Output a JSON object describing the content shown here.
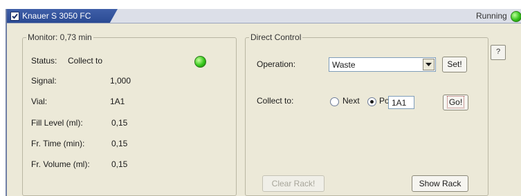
{
  "window": {
    "tab_title": "Knauer S 3050 FC",
    "enabled_checkbox": true,
    "status_text": "Running",
    "status_color": "#35c21b"
  },
  "monitor": {
    "legend": "Monitor: 0,73 min",
    "status_label": "Status:",
    "status_value": "Collect to",
    "status_led_color": "#36c81c",
    "rows": [
      {
        "label": "Signal:",
        "value": "1,000"
      },
      {
        "label": "Vial:",
        "value": "1A1"
      },
      {
        "label": "Fill Level (ml):",
        "value": "0,15"
      },
      {
        "label": "Fr. Time (min):",
        "value": "0,15"
      },
      {
        "label": "Fr. Volume (ml):",
        "value": "0,15"
      }
    ]
  },
  "help_button": {
    "label": "?"
  },
  "direct_control": {
    "legend": "Direct Control",
    "operation_label": "Operation:",
    "operation_value": "Waste",
    "set_button": "Set!",
    "collect_label": "Collect to:",
    "next_option": "Next",
    "pos_option": "Pos:",
    "selected_option": "Pos",
    "pos_value": "1A1",
    "go_button": "Go!",
    "clear_rack_button": "Clear Rack!",
    "show_rack_button": "Show Rack"
  }
}
